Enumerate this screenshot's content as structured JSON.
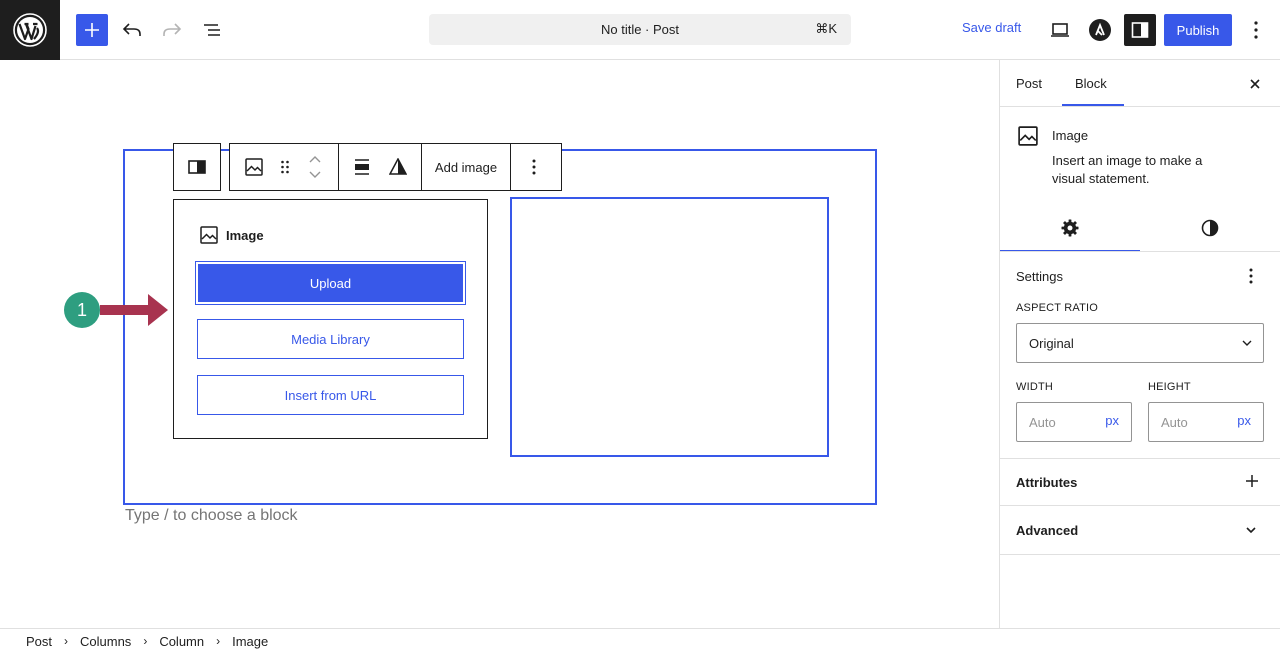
{
  "header": {
    "command_title": "No title · Post",
    "command_shortcut": "⌘K",
    "save_draft": "Save draft",
    "publish": "Publish"
  },
  "toolbar": {
    "add_image": "Add image"
  },
  "placeholder": {
    "title": "Image",
    "upload": "Upload",
    "media_library": "Media Library",
    "insert_url": "Insert from URL"
  },
  "editor": {
    "block_prompt": "Type / to choose a block"
  },
  "annotation": {
    "step_number": "1"
  },
  "sidebar": {
    "tabs": [
      "Post",
      "Block"
    ],
    "active_tab": "Block",
    "block_title": "Image",
    "block_description": "Insert an image to make a visual statement.",
    "settings_title": "Settings",
    "aspect_ratio_label": "ASPECT RATIO",
    "aspect_ratio_value": "Original",
    "width_label": "WIDTH",
    "height_label": "HEIGHT",
    "width_placeholder": "Auto",
    "height_placeholder": "Auto",
    "unit": "px",
    "attributes_title": "Attributes",
    "advanced_title": "Advanced"
  },
  "breadcrumb": [
    "Post",
    "Columns",
    "Column",
    "Image"
  ],
  "colors": {
    "accent": "#3858e9",
    "step_badge": "#2e9e80",
    "arrow": "#a8334f"
  }
}
